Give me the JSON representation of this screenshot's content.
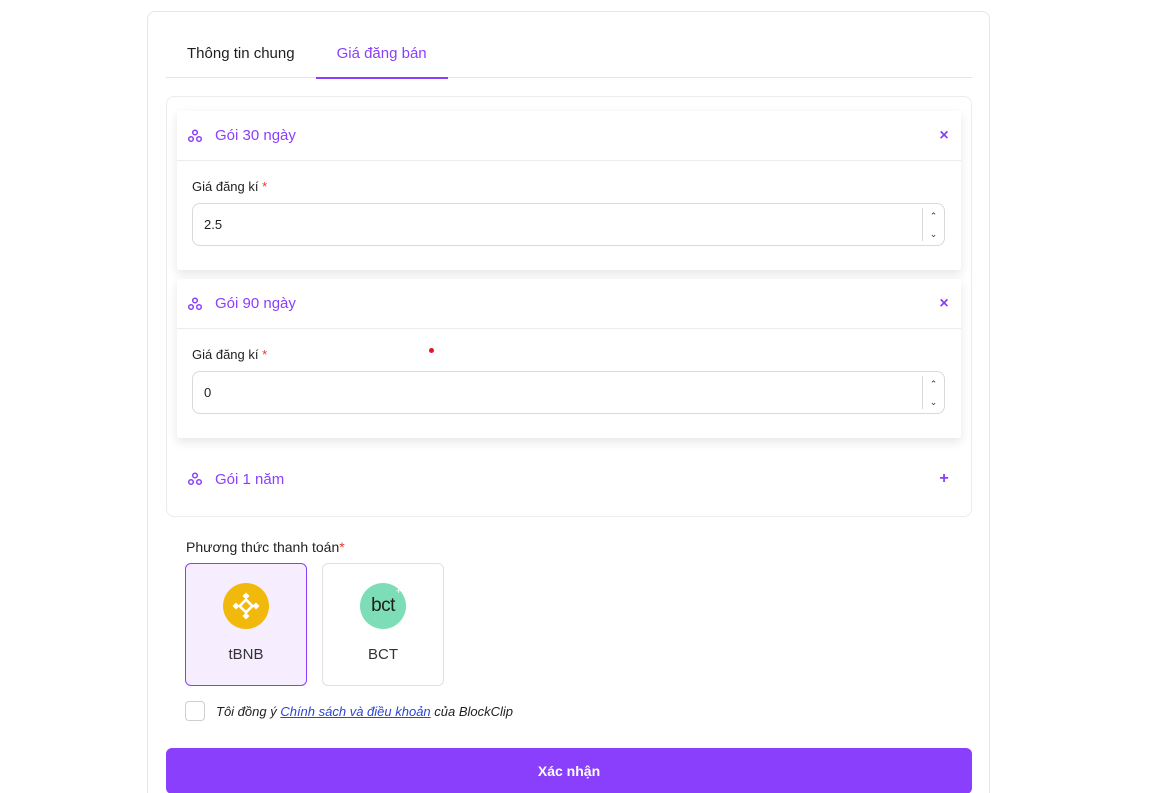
{
  "tabs": [
    {
      "label": "Thông tin chung",
      "active": false
    },
    {
      "label": "Giá đăng bán",
      "active": true
    }
  ],
  "packages": [
    {
      "title": "Gói 30 ngày",
      "expanded": true,
      "action_icon": "close-icon",
      "action_glyph": "×",
      "field_label": "Giá đăng kí",
      "required_mark": "*",
      "value": "2.5"
    },
    {
      "title": "Gói 90 ngày",
      "expanded": true,
      "action_icon": "close-icon",
      "action_glyph": "×",
      "field_label": "Giá đăng kí",
      "required_mark": "*",
      "value": "0"
    },
    {
      "title": "Gói 1 năm",
      "expanded": false,
      "action_icon": "plus-icon",
      "action_glyph": "+"
    }
  ],
  "stepper": {
    "up": "⌃",
    "down": "⌄"
  },
  "payment": {
    "label": "Phương thức thanh toán",
    "required_mark": "*",
    "options": [
      {
        "name": "tBNB",
        "icon": "bnb-coin-icon",
        "selected": true,
        "color": "#f0b90b"
      },
      {
        "name": "BCT",
        "icon": "bct-coin-icon",
        "selected": false,
        "color": "#7dddb6",
        "logo_text": "bct",
        "logo_plus": "+"
      }
    ]
  },
  "agreement": {
    "prefix": "Tôi đồng ý ",
    "link": "Chính sách và điều khoản",
    "suffix": " của BlockClip",
    "checked": false
  },
  "submit_label": "Xác nhận",
  "colors": {
    "accent": "#8a3ffc",
    "selected_bg": "#f6eefe",
    "required": "#e53935",
    "link": "#2b45d4"
  }
}
